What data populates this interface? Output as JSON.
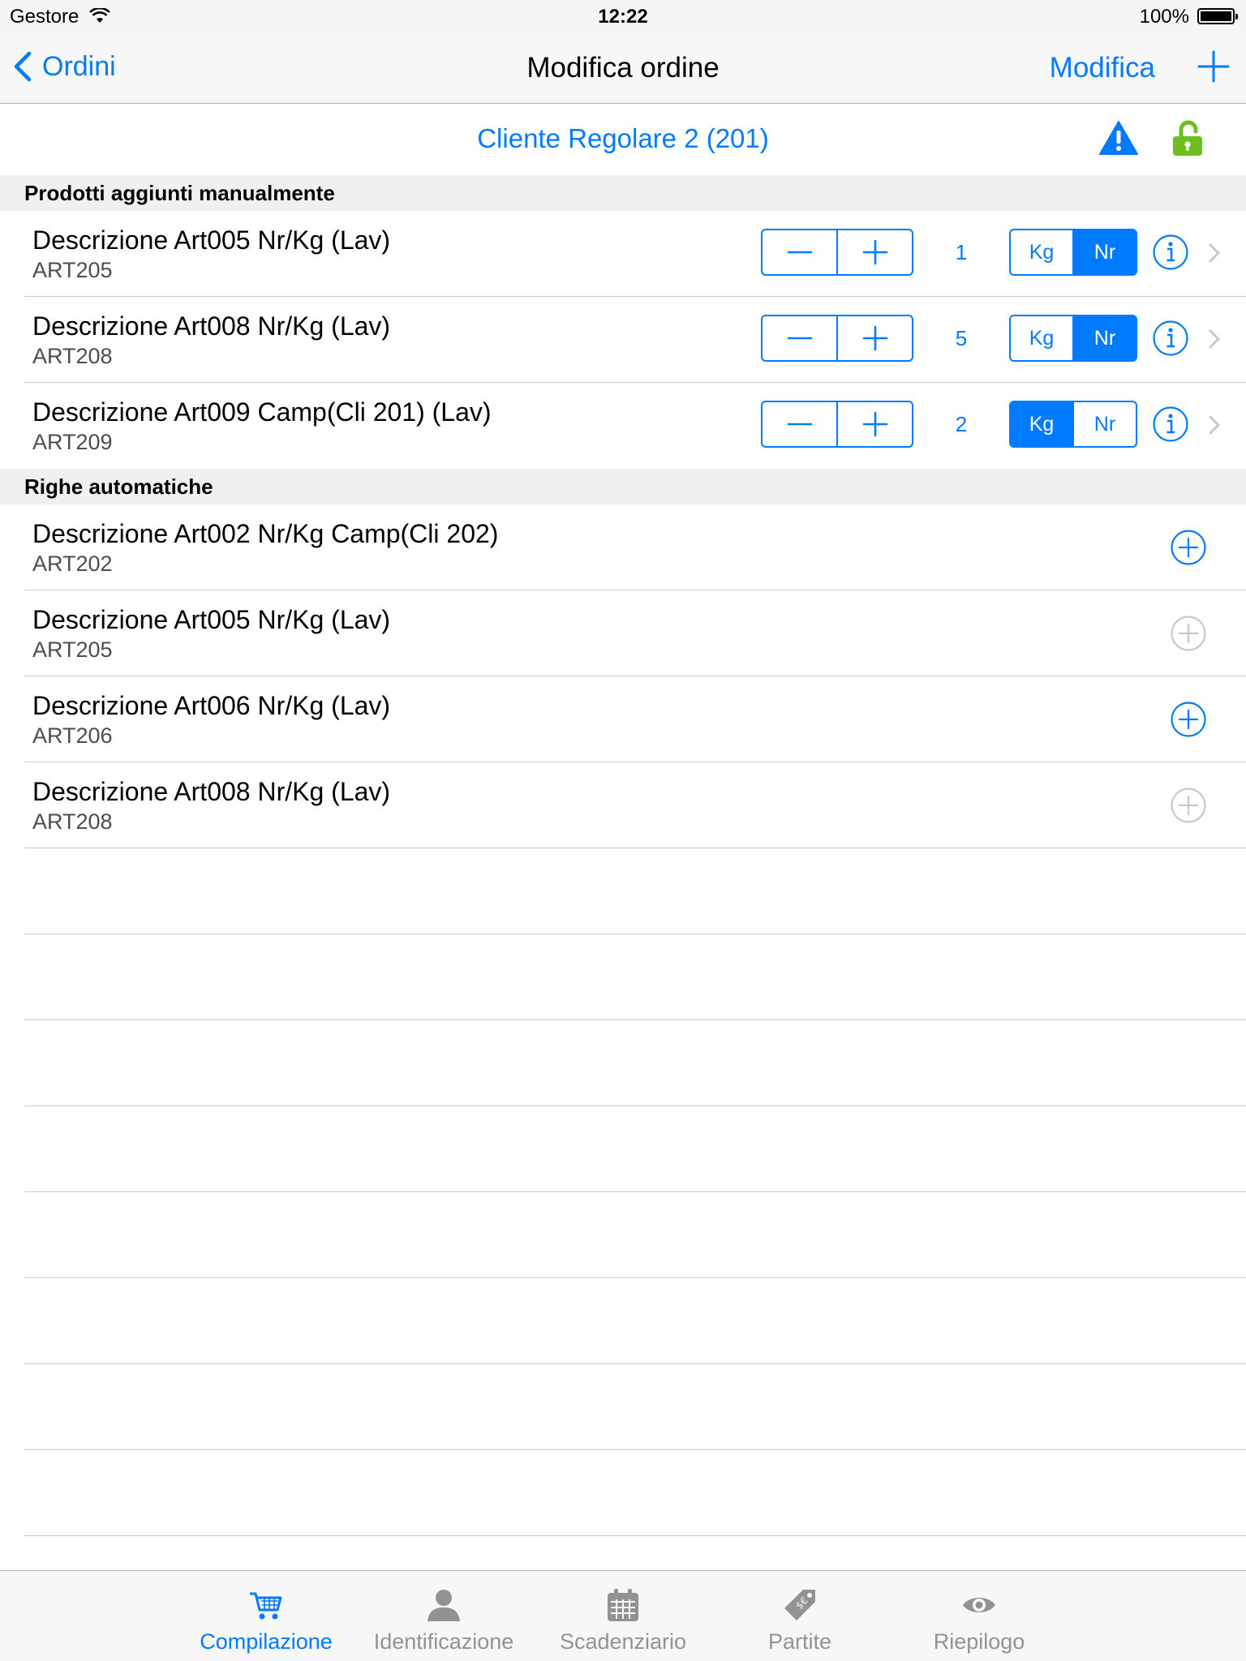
{
  "status_bar": {
    "carrier": "Gestore",
    "time": "12:22",
    "battery": "100%"
  },
  "nav": {
    "back_label": "Ordini",
    "title": "Modifica ordine",
    "edit_label": "Modifica"
  },
  "customer": {
    "name": "Cliente Regolare 2 (201)"
  },
  "sections": {
    "manual": {
      "header": "Prodotti aggiunti manualmente",
      "items": [
        {
          "title": "Descrizione Art005 Nr/Kg (Lav)",
          "code": "ART205",
          "qty": "1",
          "unit_kg": "Kg",
          "unit_nr": "Nr",
          "selected_unit": "Nr"
        },
        {
          "title": "Descrizione Art008 Nr/Kg (Lav)",
          "code": "ART208",
          "qty": "5",
          "unit_kg": "Kg",
          "unit_nr": "Nr",
          "selected_unit": "Nr"
        },
        {
          "title": "Descrizione Art009 Camp(Cli 201) (Lav)",
          "code": "ART209",
          "qty": "2",
          "unit_kg": "Kg",
          "unit_nr": "Nr",
          "selected_unit": "Kg"
        }
      ]
    },
    "auto": {
      "header": "Righe automatiche",
      "items": [
        {
          "title": "Descrizione Art002 Nr/Kg Camp(Cli 202)",
          "code": "ART202",
          "enabled": true
        },
        {
          "title": "Descrizione Art005 Nr/Kg (Lav)",
          "code": "ART205",
          "enabled": false
        },
        {
          "title": "Descrizione Art006 Nr/Kg (Lav)",
          "code": "ART206",
          "enabled": true
        },
        {
          "title": "Descrizione Art008 Nr/Kg (Lav)",
          "code": "ART208",
          "enabled": false
        }
      ]
    }
  },
  "tabs": [
    {
      "label": "Compilazione",
      "icon": "cart-icon",
      "active": true
    },
    {
      "label": "Identificazione",
      "icon": "person-icon",
      "active": false
    },
    {
      "label": "Scadenziario",
      "icon": "calendar-icon",
      "active": false
    },
    {
      "label": "Partite",
      "icon": "price-tag-icon",
      "active": false
    },
    {
      "label": "Riepilogo",
      "icon": "eye-icon",
      "active": false
    }
  ],
  "colors": {
    "accent": "#007aff",
    "warning": "#007aff",
    "lock": "#6cbf1f",
    "disabled": "#c7c7cc",
    "tab_inactive": "#929292"
  }
}
